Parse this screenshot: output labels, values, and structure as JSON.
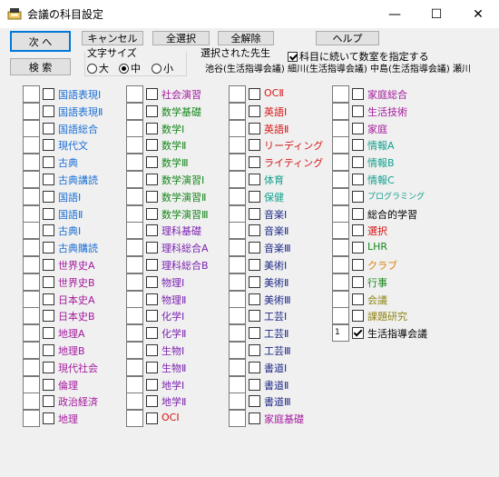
{
  "window": {
    "title": "会議の科目設定",
    "minimize_glyph": "—",
    "maximize_glyph": "☐",
    "close_glyph": "✕"
  },
  "buttons": {
    "next": "次 へ",
    "search": "検 索",
    "cancel": "キャンセル",
    "select_all": "全選択",
    "deselect_all": "全解除",
    "help": "ヘルプ"
  },
  "font_size": {
    "label": "文字サイズ",
    "options": [
      "大",
      "中",
      "小"
    ],
    "selected": "中"
  },
  "teachers": {
    "label": "選択された先生",
    "checkbox_label": "科目に続いて数室を指定する",
    "checkbox_checked": true,
    "list": "池谷(生活指導会議) 細川(生活指導会議) 中島(生活指導会議) 瀬川"
  },
  "colors": {
    "blue": "#1c6fd4",
    "purple": "#a51b9e",
    "red": "#d81414",
    "green": "#16871c",
    "teal": "#13a08e",
    "orange": "#dd8000",
    "olive": "#8e8413",
    "navy": "#1f2a87",
    "violet": "#7b22b0",
    "black": "#000000"
  },
  "columns": [
    [
      {
        "label": "国語表現Ⅰ",
        "color": "#1c6fd4"
      },
      {
        "label": "国語表現Ⅱ",
        "color": "#1c6fd4"
      },
      {
        "label": "国語総合",
        "color": "#1c6fd4"
      },
      {
        "label": "現代文",
        "color": "#1c6fd4"
      },
      {
        "label": "古典",
        "color": "#1c6fd4"
      },
      {
        "label": "古典講読",
        "color": "#1c6fd4"
      },
      {
        "label": "国語Ⅰ",
        "color": "#1c6fd4"
      },
      {
        "label": "国語Ⅱ",
        "color": "#1c6fd4"
      },
      {
        "label": "古典Ⅰ",
        "color": "#1c6fd4"
      },
      {
        "label": "古典購読",
        "color": "#1c6fd4"
      },
      {
        "label": "世界史A",
        "color": "#a51b9e"
      },
      {
        "label": "世界史B",
        "color": "#a51b9e"
      },
      {
        "label": "日本史A",
        "color": "#a51b9e"
      },
      {
        "label": "日本史B",
        "color": "#a51b9e"
      },
      {
        "label": "地理A",
        "color": "#a51b9e"
      },
      {
        "label": "地理B",
        "color": "#a51b9e"
      },
      {
        "label": "現代社会",
        "color": "#a51b9e"
      },
      {
        "label": "倫理",
        "color": "#a51b9e"
      },
      {
        "label": "政治経済",
        "color": "#a51b9e"
      },
      {
        "label": "地理",
        "color": "#a51b9e"
      }
    ],
    [
      {
        "label": "社会演習",
        "color": "#a51b9e"
      },
      {
        "label": "数学基礎",
        "color": "#16871c"
      },
      {
        "label": "数学Ⅰ",
        "color": "#16871c"
      },
      {
        "label": "数学Ⅱ",
        "color": "#16871c"
      },
      {
        "label": "数学Ⅲ",
        "color": "#16871c"
      },
      {
        "label": "数学演習Ⅰ",
        "color": "#16871c"
      },
      {
        "label": "数学演習Ⅱ",
        "color": "#16871c"
      },
      {
        "label": "数学演習Ⅲ",
        "color": "#16871c"
      },
      {
        "label": "理科基礎",
        "color": "#7b22b0"
      },
      {
        "label": "理科総合A",
        "color": "#7b22b0"
      },
      {
        "label": "理科総合B",
        "color": "#7b22b0"
      },
      {
        "label": "物理Ⅰ",
        "color": "#7b22b0"
      },
      {
        "label": "物理Ⅱ",
        "color": "#7b22b0"
      },
      {
        "label": "化学Ⅰ",
        "color": "#7b22b0"
      },
      {
        "label": "化学Ⅱ",
        "color": "#7b22b0"
      },
      {
        "label": "生物Ⅰ",
        "color": "#7b22b0"
      },
      {
        "label": "生物Ⅱ",
        "color": "#7b22b0"
      },
      {
        "label": "地学Ⅰ",
        "color": "#7b22b0"
      },
      {
        "label": "地学Ⅱ",
        "color": "#7b22b0"
      },
      {
        "label": "OCⅠ",
        "color": "#d81414"
      }
    ],
    [
      {
        "label": "OCⅡ",
        "color": "#d81414"
      },
      {
        "label": "英語Ⅰ",
        "color": "#d81414"
      },
      {
        "label": "英語Ⅱ",
        "color": "#d81414"
      },
      {
        "label": "リーディング",
        "color": "#d81414"
      },
      {
        "label": "ライティング",
        "color": "#d81414"
      },
      {
        "label": "体育",
        "color": "#13a08e"
      },
      {
        "label": "保健",
        "color": "#13a08e"
      },
      {
        "label": "音楽Ⅰ",
        "color": "#1f2a87"
      },
      {
        "label": "音楽Ⅱ",
        "color": "#1f2a87"
      },
      {
        "label": "音楽Ⅲ",
        "color": "#1f2a87"
      },
      {
        "label": "美術Ⅰ",
        "color": "#1f2a87"
      },
      {
        "label": "美術Ⅱ",
        "color": "#1f2a87"
      },
      {
        "label": "美術Ⅲ",
        "color": "#1f2a87"
      },
      {
        "label": "工芸Ⅰ",
        "color": "#1f2a87"
      },
      {
        "label": "工芸Ⅱ",
        "color": "#1f2a87"
      },
      {
        "label": "工芸Ⅲ",
        "color": "#1f2a87"
      },
      {
        "label": "書道Ⅰ",
        "color": "#1f2a87"
      },
      {
        "label": "書道Ⅱ",
        "color": "#1f2a87"
      },
      {
        "label": "書道Ⅲ",
        "color": "#1f2a87"
      },
      {
        "label": "家庭基礎",
        "color": "#a51b9e"
      }
    ],
    [
      {
        "label": "家庭総合",
        "color": "#a51b9e"
      },
      {
        "label": "生活技術",
        "color": "#a51b9e"
      },
      {
        "label": "家庭",
        "color": "#a51b9e"
      },
      {
        "label": "情報A",
        "color": "#13a08e"
      },
      {
        "label": "情報B",
        "color": "#13a08e"
      },
      {
        "label": "情報C",
        "color": "#13a08e"
      },
      {
        "label": "プログラミング",
        "color": "#13a08e",
        "small": true
      },
      {
        "label": "総合的学習",
        "color": "#000000"
      },
      {
        "label": "選択",
        "color": "#d81414"
      },
      {
        "label": "LHR",
        "color": "#16871c"
      },
      {
        "label": "クラブ",
        "color": "#dd8000"
      },
      {
        "label": "行事",
        "color": "#16871c"
      },
      {
        "label": "会議",
        "color": "#8e8413"
      },
      {
        "label": "課題研究",
        "color": "#8e8413"
      },
      {
        "label": "生活指導会議",
        "color": "#000000",
        "number": "1",
        "checked": true
      }
    ]
  ]
}
